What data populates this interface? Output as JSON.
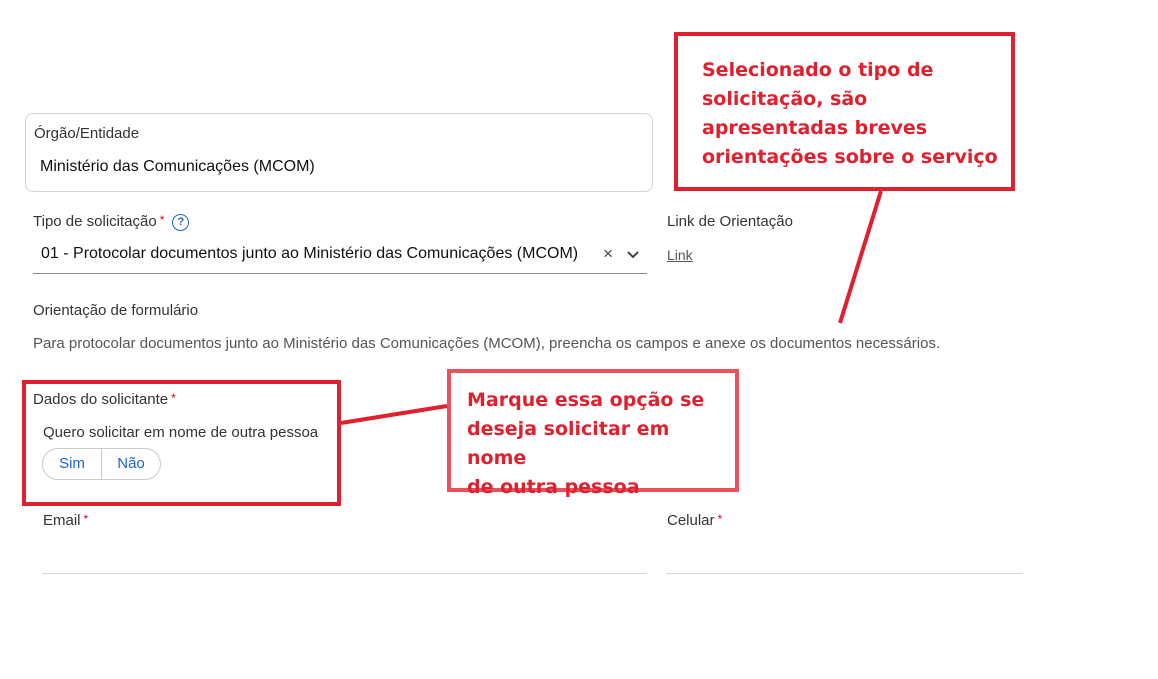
{
  "org": {
    "label": "Órgão/Entidade",
    "value": "Ministério das Comunicações (MCOM)"
  },
  "tipo": {
    "label": "Tipo de solicitação",
    "required_mark": "*",
    "help_icon": "help-circle-icon",
    "value": "01 - Protocolar documentos junto ao Ministério das Comunicações (MCOM)",
    "clear_glyph": "×"
  },
  "link_orientacao": {
    "label": "Link de Orientação",
    "link_text": "Link"
  },
  "orientacao": {
    "label": "Orientação de formulário",
    "text": "Para protocolar documentos junto ao Ministério das Comunicações (MCOM), preencha os campos e anexe os documentos necessários."
  },
  "dados": {
    "label": "Dados do solicitante",
    "required_mark": "*",
    "question": "Quero solicitar em nome de outra pessoa",
    "options": [
      "Sim",
      "Não"
    ]
  },
  "email": {
    "label": "Email",
    "required_mark": "*"
  },
  "celular": {
    "label": "Celular",
    "required_mark": "*"
  },
  "annotations": {
    "top": {
      "lines": [
        "Selecionado o tipo de",
        "solicitação, são",
        "apresentadas breves",
        "orientações sobre o serviço"
      ]
    },
    "middle": {
      "lines": [
        "Marque essa opção se",
        "deseja solicitar em nome",
        "de outra pessoa"
      ]
    }
  },
  "colors": {
    "annotation": "#e0202e",
    "link_blue": "#1f63c9",
    "required": "#d0021b"
  }
}
